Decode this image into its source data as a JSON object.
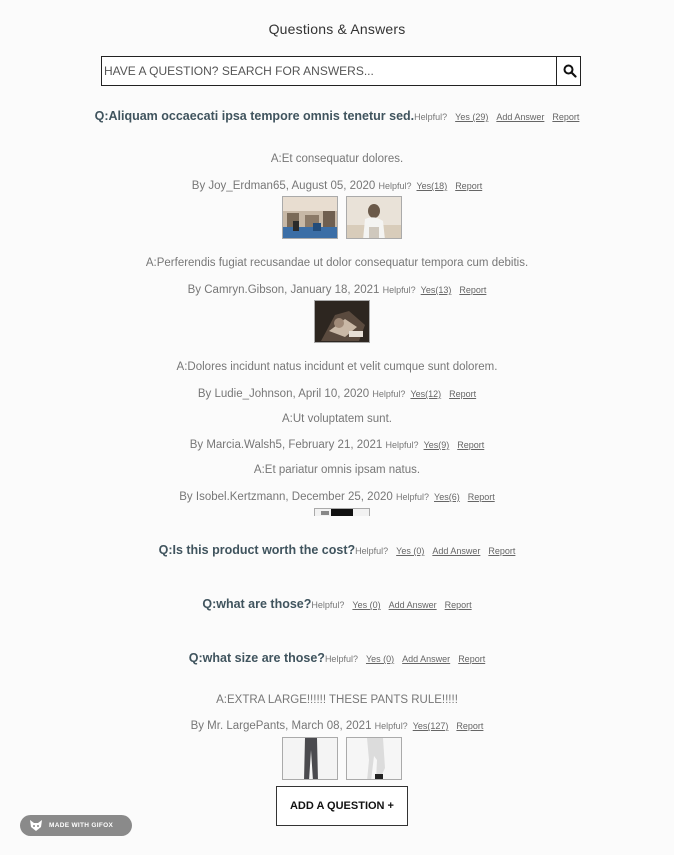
{
  "title": "Questions & Answers",
  "search": {
    "placeholder": "HAVE A QUESTION? SEARCH FOR ANSWERS...",
    "icon": "search-icon"
  },
  "labels": {
    "helpful": "Helpful?",
    "add_answer": "Add Answer",
    "report": "Report"
  },
  "questions": [
    {
      "text": "Q:Aliquam occaecati ipsa tempore omnis tenetur sed.",
      "yes": "Yes (29)",
      "answers": [
        {
          "body": "A:Et consequatur dolores.",
          "by": "By Joy_Erdman65, August 05, 2020",
          "yes": "Yes(18)"
        },
        {
          "body": "A:Perferendis fugiat recusandae ut dolor consequatur tempora cum debitis.",
          "by": "By Camryn.Gibson, January 18, 2021",
          "yes": "Yes(13)"
        },
        {
          "body": "A:Dolores incidunt natus incidunt et velit cumque sunt dolorem.",
          "by": "By Ludie_Johnson, April 10, 2020",
          "yes": "Yes(12)"
        },
        {
          "body": "A:Ut voluptatem sunt.",
          "by": "By Marcia.Walsh5, February 21, 2021",
          "yes": "Yes(9)"
        },
        {
          "body": "A:Et pariatur omnis ipsam natus.",
          "by": "By Isobel.Kertzmann, December 25, 2020",
          "yes": "Yes(6)"
        }
      ]
    },
    {
      "text": "Q:Is this product worth the cost?",
      "yes": "Yes (0)",
      "answers": []
    },
    {
      "text": "Q:what are those?",
      "yes": "Yes (0)",
      "answers": []
    },
    {
      "text": "Q:what size are those?",
      "yes": "Yes (0)",
      "answers": [
        {
          "body": "A:EXTRA LARGE!!!!!! THESE PANTS RULE!!!!!",
          "by": "By Mr. LargePants, March 08, 2021",
          "yes": "Yes(127)"
        }
      ]
    }
  ],
  "add_question": "ADD A QUESTION +",
  "badge": "MADE WITH GIFOX"
}
